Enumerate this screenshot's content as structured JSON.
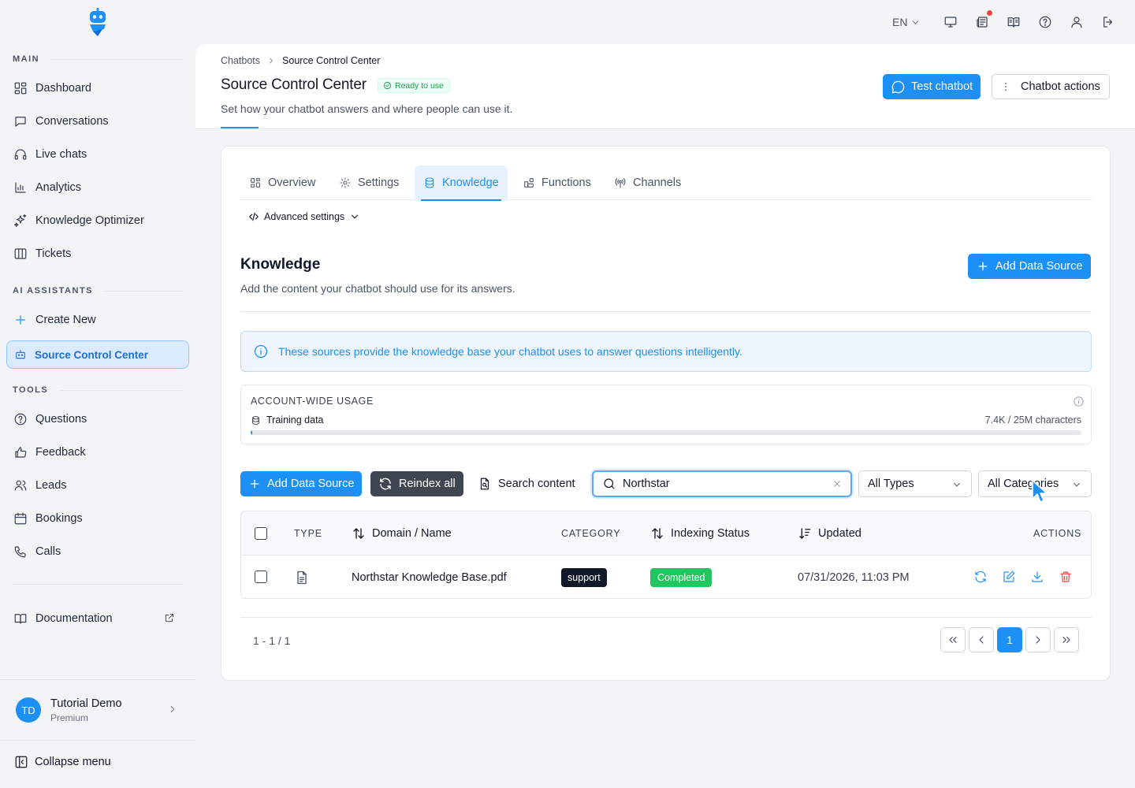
{
  "sidebar": {
    "sections": {
      "main": "MAIN",
      "ai": "AI ASSISTANTS",
      "tools": "TOOLS"
    },
    "main_items": [
      "Dashboard",
      "Conversations",
      "Live chats",
      "Analytics",
      "Knowledge Optimizer",
      "Tickets"
    ],
    "ai_items": [
      "Create New",
      "Source Control Center"
    ],
    "tools_items": [
      "Questions",
      "Feedback",
      "Leads",
      "Bookings",
      "Calls"
    ],
    "documentation": "Documentation",
    "user": {
      "initials": "TD",
      "name": "Tutorial Demo",
      "plan": "Premium"
    },
    "collapse": "Collapse menu"
  },
  "topbar": {
    "language": "EN"
  },
  "header": {
    "breadcrumb": [
      "Chatbots",
      "Source Control Center"
    ],
    "title": "Source Control Center",
    "status": "Ready to use",
    "description": "Set how your chatbot answers and where people can use it.",
    "test_button": "Test chatbot",
    "actions_button": "Chatbot actions"
  },
  "tabs": [
    "Overview",
    "Settings",
    "Knowledge",
    "Functions",
    "Channels"
  ],
  "advanced_settings": "Advanced settings",
  "knowledge": {
    "title": "Knowledge",
    "description": "Add the content your chatbot should use for its answers.",
    "add_source": "Add Data Source",
    "info": "These sources provide the knowledge base your chatbot uses to answer questions intelligently."
  },
  "usage": {
    "title": "ACCOUNT-WIDE USAGE",
    "label": "Training data",
    "value": "7.4K / 25M characters",
    "fraction": 0.0003
  },
  "toolbar": {
    "add_source": "Add Data Source",
    "reindex": "Reindex all",
    "search_content": "Search content",
    "search_value": "Northstar",
    "type_filter": "All Types",
    "category_filter": "All Categories"
  },
  "table": {
    "headers": {
      "type": "TYPE",
      "name": "Domain / Name",
      "category": "CATEGORY",
      "status": "Indexing Status",
      "updated": "Updated",
      "actions": "ACTIONS"
    },
    "rows": [
      {
        "name": "Northstar Knowledge Base.pdf",
        "category": "support",
        "status": "Completed",
        "updated": "07/31/2026, 11:03 PM"
      }
    ]
  },
  "pagination": {
    "range": "1 - 1 / 1",
    "current_page": "1"
  },
  "colors": {
    "accent": "#1d90f5",
    "success": "#22c55e",
    "danger": "#ef4444"
  }
}
